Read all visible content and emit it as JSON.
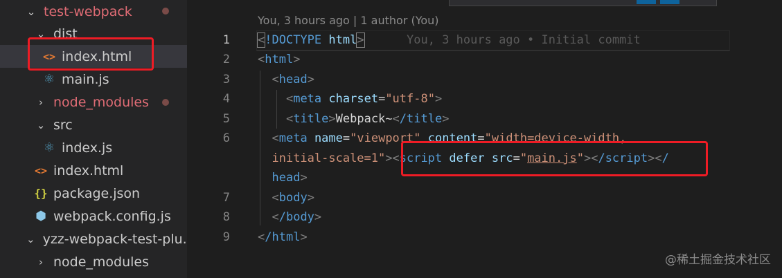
{
  "explorer": {
    "items": [
      {
        "label": "test-webpack",
        "kind": "folder-open",
        "indent": 0,
        "modified": true
      },
      {
        "label": "dist",
        "kind": "folder-open",
        "indent": 1
      },
      {
        "label": "index.html",
        "kind": "html",
        "indent": 2,
        "selected": true
      },
      {
        "label": "main.js",
        "kind": "js",
        "indent": 2
      },
      {
        "label": "node_modules",
        "kind": "folder-closed",
        "indent": 1,
        "modified": true
      },
      {
        "label": "src",
        "kind": "folder-open",
        "indent": 1
      },
      {
        "label": "index.js",
        "kind": "js",
        "indent": 2
      },
      {
        "label": "index.html",
        "kind": "html",
        "indent": 1
      },
      {
        "label": "package.json",
        "kind": "json",
        "indent": 1
      },
      {
        "label": "webpack.config.js",
        "kind": "config",
        "indent": 1
      },
      {
        "label": "yzz-webpack-test-plu...",
        "kind": "folder-open",
        "indent": 0
      },
      {
        "label": "node_modules",
        "kind": "folder-closed",
        "indent": 1
      }
    ]
  },
  "editor": {
    "blame_header": "You, 3 hours ago | 1 author (You)",
    "inline_blame": "You, 3 hours ago • Initial commit",
    "line_numbers": [
      "1",
      "2",
      "3",
      "4",
      "5",
      "6",
      "",
      "",
      "7",
      "8",
      "9"
    ],
    "code": {
      "l1_doctype": "!DOCTYPE",
      "l1_html": "html",
      "l2_html": "html",
      "l3_head": "head",
      "l4_meta": "meta",
      "l4_attr": "charset",
      "l4_val": "\"utf-8\"",
      "l5_title": "title",
      "l5_text": "Webpack~",
      "l5_title_close": "/title",
      "l6_meta": "meta",
      "l6_attr1": "name",
      "l6_val1": "\"viewport\"",
      "l6_attr2": "content",
      "l6_val2": "\"width=device-width,",
      "l6b_val2": "initial-scale=1\"",
      "l6b_script": "script",
      "l6b_defer": "defer",
      "l6b_src": "src",
      "l6b_src_q1": "\"",
      "l6b_src_val": "main.js",
      "l6b_src_q2": "\"",
      "l6b_script_close": "/script",
      "l6b_head_close_start": "/",
      "l6c_head": "head",
      "l7_body": "body",
      "l8_body_close": "/body",
      "l9_html_close": "/html"
    }
  },
  "watermark": "@稀土掘金技术社区",
  "colors": {
    "highlight_box": "#ee1c25",
    "tag": "#569cd6",
    "attribute": "#9cdcfe",
    "string": "#ce9178",
    "folder_modified": "#e06c75"
  }
}
